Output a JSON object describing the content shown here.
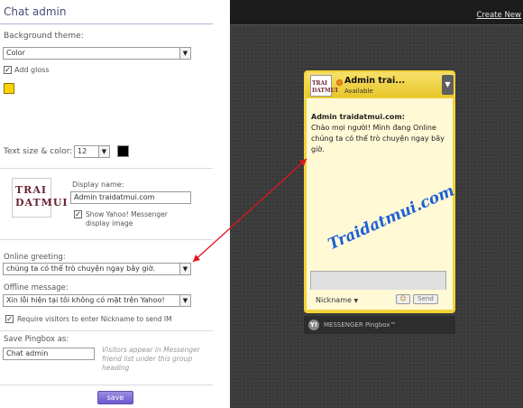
{
  "panel": {
    "title": "Chat admin",
    "background_theme": {
      "label": "Background theme:",
      "value": "Color"
    },
    "add_gloss": {
      "label": "Add gloss",
      "checked": true
    },
    "theme_color": "#ffd200",
    "text_size_color": {
      "label": "Text size & color:",
      "size": "12",
      "color": "#000000"
    },
    "logo_text": [
      "TRAI",
      "DATMUI"
    ],
    "display_name": {
      "label": "Display name:",
      "value": "Admin traidatmui.com"
    },
    "show_image": {
      "label": "Show Yahoo! Messenger display image",
      "checked": true
    },
    "online_greeting": {
      "label": "Online greeting:",
      "value": "chúng ta có thể trò chuyện ngay bây giờ."
    },
    "offline_message": {
      "label": "Offline message:",
      "value": "Xin lỗi hiện tại tôi không có mặt trên Yahoo!"
    },
    "require_nickname": {
      "label": "Require visitors to enter Nickname to send IM",
      "checked": true
    },
    "save_as": {
      "label": "Save Pingbox as:",
      "value": "Chat admin",
      "hint": "Visitors appear in Messenger friend list under this group heading"
    },
    "save_button": "save"
  },
  "preview": {
    "create_link": "Create New",
    "pingbox": {
      "name": "Admin trai...",
      "status": "Available",
      "avatar_text": [
        "TRAI",
        "DATMUI"
      ],
      "sender": "Admin traidatmui.com",
      "message": "Chào mọi người! Mình đang Online chúng ta có thể trò chuyện ngay bây giờ.",
      "nickname_label": "Nickname",
      "send_label": "Send",
      "brand": "MESSENGER Pingbox™"
    },
    "watermark": "Traidatmui.com"
  }
}
